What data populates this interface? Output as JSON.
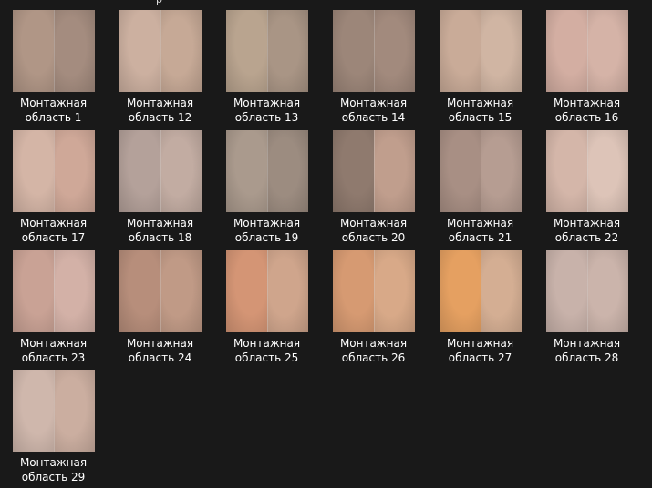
{
  "top_fragment": "р",
  "files": [
    {
      "name_line1": "Монтажная",
      "name_line2": "область 1",
      "colors": [
        "#b09686",
        "#a48c7f"
      ]
    },
    {
      "name_line1": "Монтажная",
      "name_line2": "область 12",
      "colors": [
        "#ccb0a0",
        "#c6a996"
      ]
    },
    {
      "name_line1": "Монтажная",
      "name_line2": "область 13",
      "colors": [
        "#b9a48f",
        "#a99585"
      ]
    },
    {
      "name_line1": "Монтажная",
      "name_line2": "область 14",
      "colors": [
        "#9c8679",
        "#a28a7d"
      ]
    },
    {
      "name_line1": "Монтажная",
      "name_line2": "область 15",
      "colors": [
        "#c9ab98",
        "#d0b5a3"
      ]
    },
    {
      "name_line1": "Монтажная",
      "name_line2": "область 16",
      "colors": [
        "#d3aea2",
        "#d5b3a7"
      ]
    },
    {
      "name_line1": "Монтажная",
      "name_line2": "область 17",
      "colors": [
        "#d4b5a6",
        "#cfa898"
      ]
    },
    {
      "name_line1": "Монтажная",
      "name_line2": "область 18",
      "colors": [
        "#b4a19a",
        "#c2aca2"
      ]
    },
    {
      "name_line1": "Монтажная",
      "name_line2": "область 19",
      "colors": [
        "#aa9a8d",
        "#9c8c80"
      ]
    },
    {
      "name_line1": "Монтажная",
      "name_line2": "область 20",
      "colors": [
        "#8f7a6e",
        "#c09e8d"
      ]
    },
    {
      "name_line1": "Монтажная",
      "name_line2": "область 21",
      "colors": [
        "#a88f84",
        "#b69d92"
      ]
    },
    {
      "name_line1": "Монтажная",
      "name_line2": "область 22",
      "colors": [
        "#d4b6a9",
        "#ddc4b8"
      ]
    },
    {
      "name_line1": "Монтажная",
      "name_line2": "область 23",
      "colors": [
        "#c9a295",
        "#d3b1a7"
      ]
    },
    {
      "name_line1": "Монтажная",
      "name_line2": "область 24",
      "colors": [
        "#b78e7b",
        "#c09a86"
      ]
    },
    {
      "name_line1": "Монтажная",
      "name_line2": "область 25",
      "colors": [
        "#d49575",
        "#cfa58c"
      ]
    },
    {
      "name_line1": "Монтажная",
      "name_line2": "область 26",
      "colors": [
        "#d69a72",
        "#d8a988"
      ]
    },
    {
      "name_line1": "Монтажная",
      "name_line2": "область 27",
      "colors": [
        "#e5a061",
        "#d4ae93"
      ]
    },
    {
      "name_line1": "Монтажная",
      "name_line2": "область 28",
      "colors": [
        "#c8b2aa",
        "#cbb4ab"
      ]
    },
    {
      "name_line1": "Монтажная",
      "name_line2": "область 29",
      "colors": [
        "#cfb7ac",
        "#cbaea0"
      ]
    }
  ]
}
